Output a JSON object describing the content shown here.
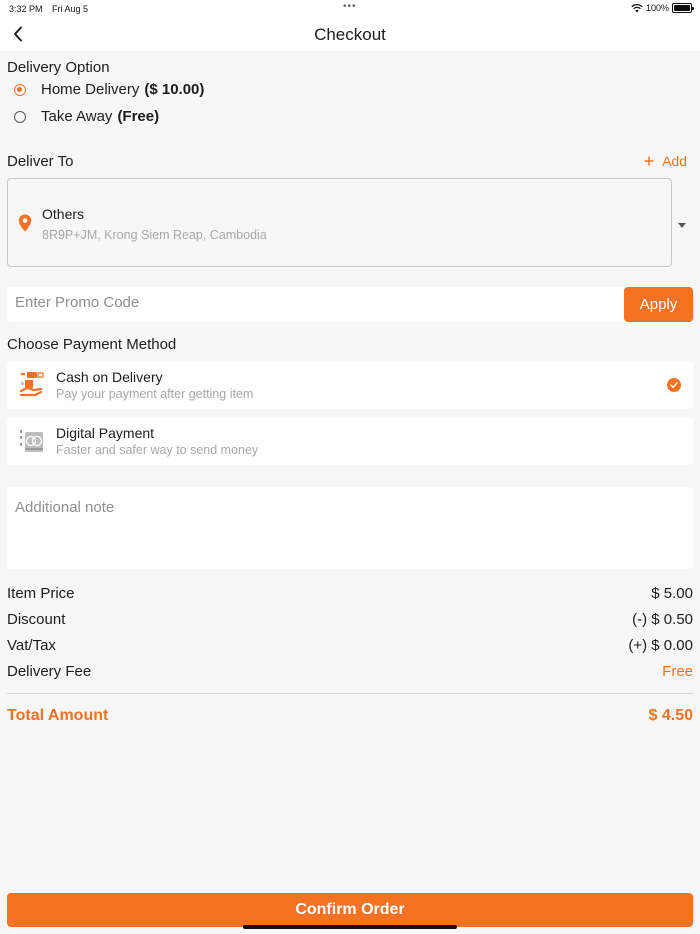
{
  "status_bar": {
    "time": "3:32 PM",
    "date": "Fri Aug 5",
    "battery": "100%"
  },
  "header": {
    "title": "Checkout",
    "back_icon": "chevron-left-icon"
  },
  "delivery_option": {
    "title": "Delivery Option",
    "options": [
      {
        "label": "Home Delivery",
        "price": "($ 10.00)",
        "selected": true
      },
      {
        "label": "Take Away",
        "price": "(Free)",
        "selected": false
      }
    ]
  },
  "deliver_to": {
    "title": "Deliver To",
    "add_label": "Add",
    "address_name": "Others",
    "address_line": "8R9P+JM, Krong Siem Reap, Cambodia"
  },
  "promo": {
    "placeholder": "Enter Promo Code",
    "apply_label": "Apply"
  },
  "payment": {
    "title": "Choose Payment Method",
    "methods": [
      {
        "title": "Cash on Delivery",
        "subtitle": "Pay your payment after getting item",
        "selected": true
      },
      {
        "title": "Digital Payment",
        "subtitle": "Faster and safer way to send money",
        "selected": false
      }
    ]
  },
  "note": {
    "placeholder": "Additional note"
  },
  "summary": {
    "item_price": {
      "label": "Item Price",
      "value": "$ 5.00"
    },
    "discount": {
      "label": "Discount",
      "value": "(-) $ 0.50"
    },
    "vat": {
      "label": "Vat/Tax",
      "value": "(+) $ 0.00"
    },
    "delivery_fee": {
      "label": "Delivery Fee",
      "value": "Free"
    },
    "total": {
      "label": "Total Amount",
      "value": "$ 4.50"
    }
  },
  "confirm_label": "Confirm Order",
  "colors": {
    "accent": "#f57224",
    "background": "#f7f7f7",
    "card": "#ffffff",
    "muted_text": "#a8a8a8"
  }
}
